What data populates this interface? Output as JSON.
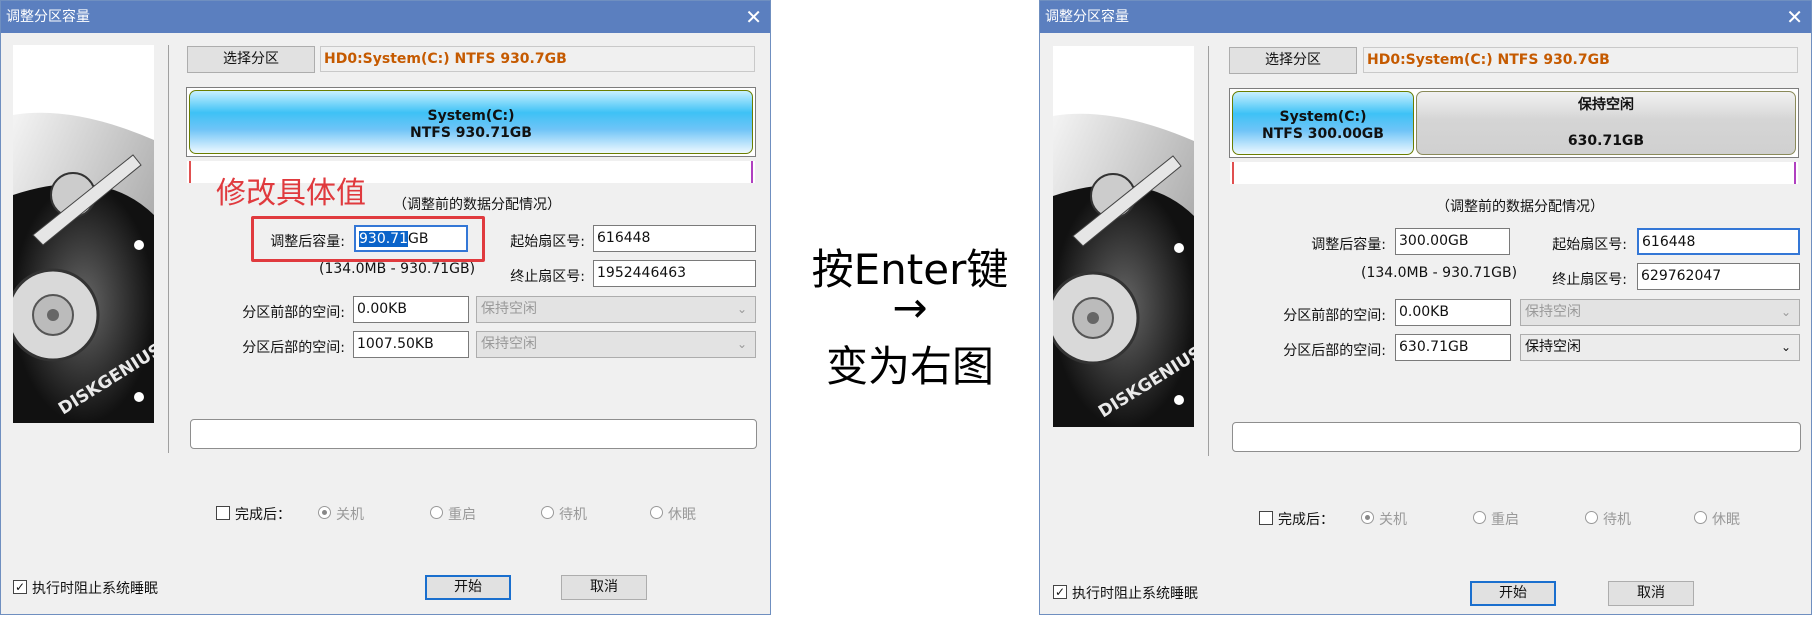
{
  "middle": {
    "line1": "按Enter键",
    "arrow": "→",
    "line2": "变为右图"
  },
  "left": {
    "title": "调整分区容量",
    "close_icon": "close-icon",
    "select_partition_button": "选择分区",
    "partition_path": "HD0:System(C:) NTFS 930.7GB",
    "segments": [
      {
        "name": "System(C:)",
        "detail": "NTFS 930.71GB"
      }
    ],
    "annotation": "修改具体值",
    "section_title": "（调整前的数据分配情况）",
    "size_label": "调整后容量:",
    "size_value_selected": "930.71",
    "size_value_rest": "GB",
    "range_text": "(134.0MB - 930.71GB)",
    "start_sector_label": "起始扇区号:",
    "start_sector_value": "616448",
    "end_sector_label": "终止扇区号:",
    "end_sector_value": "1952446463",
    "before_space_label": "分区前部的空间:",
    "before_space_value": "0.00KB",
    "before_space_option": "保持空闲",
    "after_space_label": "分区后部的空间:",
    "after_space_value": "1007.50KB",
    "after_space_option": "保持空闲",
    "after_complete_label": "完成后：",
    "radios": [
      "关机",
      "重启",
      "待机",
      "休眠"
    ],
    "prevent_sleep_label": "执行时阻止系统睡眠",
    "start_button": "开始",
    "cancel_button": "取消"
  },
  "right": {
    "title": "调整分区容量",
    "close_icon": "close-icon",
    "select_partition_button": "选择分区",
    "partition_path": "HD0:System(C:) NTFS 930.7GB",
    "segments": [
      {
        "name": "System(C:)",
        "detail": "NTFS 300.00GB"
      },
      {
        "name": "保持空闲",
        "detail": "630.71GB"
      }
    ],
    "section_title": "（调整前的数据分配情况）",
    "size_label": "调整后容量:",
    "size_value": "300.00GB",
    "range_text": "(134.0MB - 930.71GB)",
    "start_sector_label": "起始扇区号:",
    "start_sector_value": "616448",
    "end_sector_label": "终止扇区号:",
    "end_sector_value": "629762047",
    "before_space_label": "分区前部的空间:",
    "before_space_value": "0.00KB",
    "before_space_option": "保持空闲",
    "after_space_label": "分区后部的空间:",
    "after_space_value": "630.71GB",
    "after_space_option": "保持空闲",
    "after_complete_label": "完成后：",
    "radios": [
      "关机",
      "重启",
      "待机",
      "休眠"
    ],
    "prevent_sleep_label": "执行时阻止系统睡眠",
    "start_button": "开始",
    "cancel_button": "取消"
  },
  "art_text": "DISKGENIUS",
  "colors": {
    "titlebar": "#5b7fbf",
    "partition_path": "#c55a00",
    "annotation": "#e03a3e",
    "selection": "#0a63c9",
    "focus_border": "#3477d6"
  }
}
